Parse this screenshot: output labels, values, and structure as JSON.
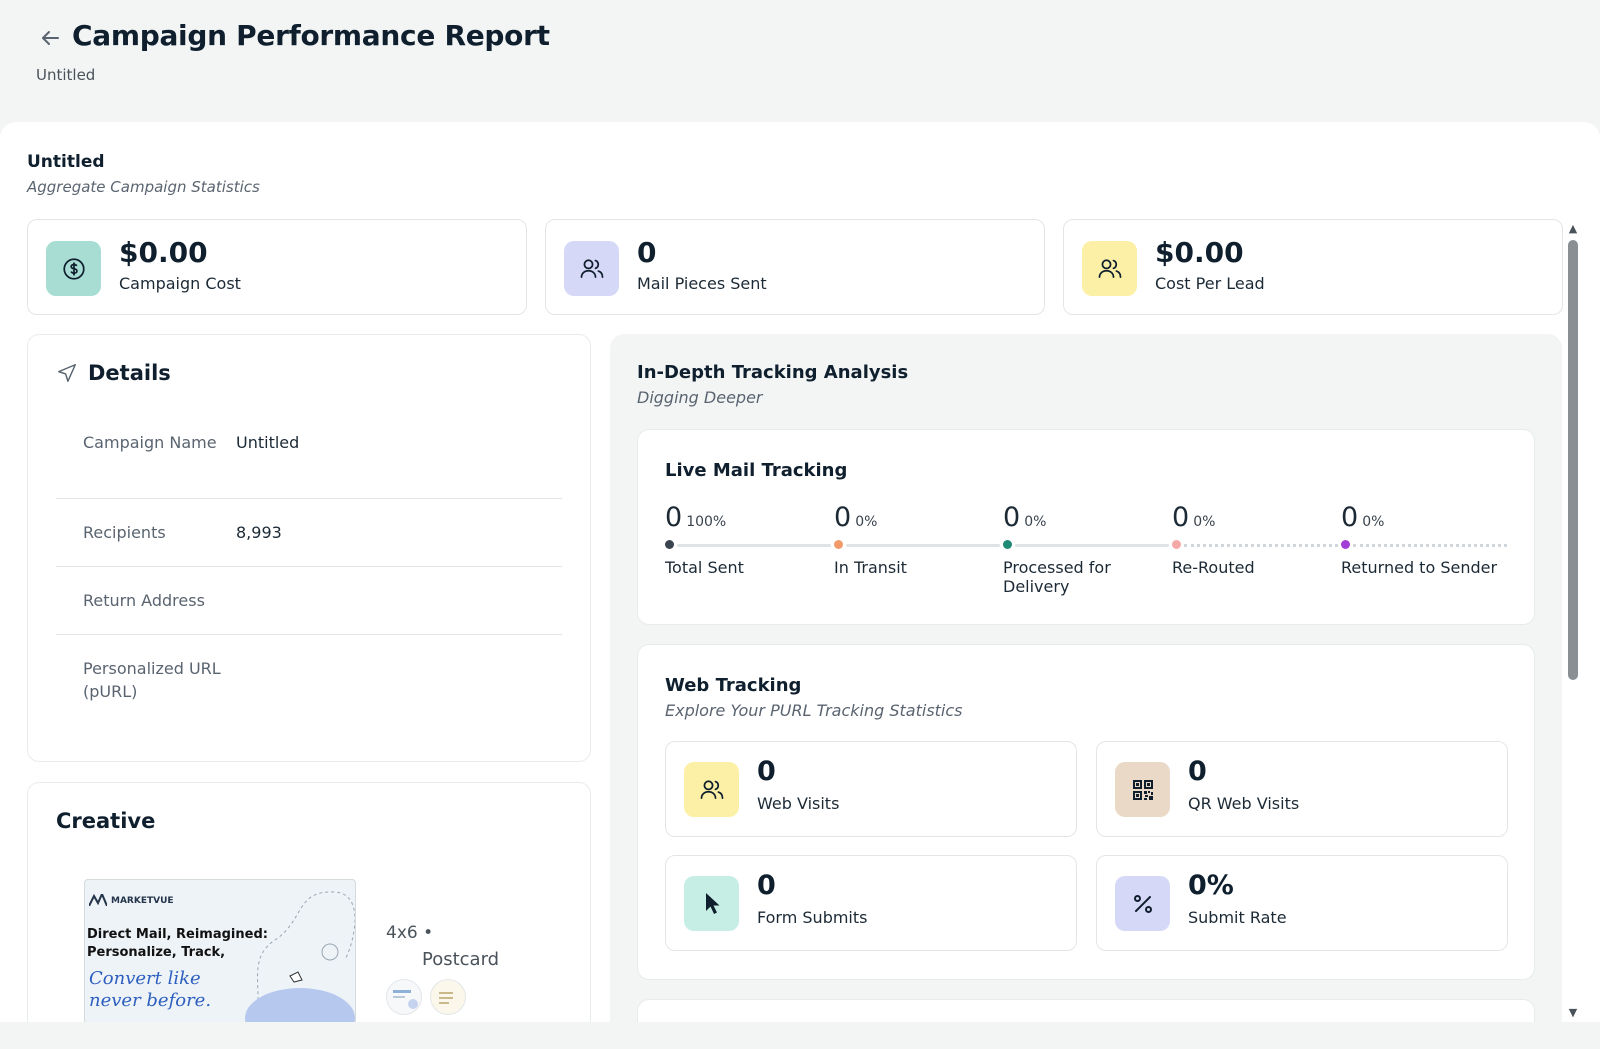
{
  "header": {
    "title": "Campaign Performance Report",
    "subtitle": "Untitled"
  },
  "summary": {
    "name": "Untitled",
    "subtitle": "Aggregate Campaign Statistics",
    "stats": [
      {
        "value": "$0.00",
        "label": "Campaign Cost",
        "icon": "dollar-circle-icon",
        "color": "#a8ddd4"
      },
      {
        "value": "0",
        "label": "Mail Pieces Sent",
        "icon": "users-icon",
        "color": "#d6d8f7"
      },
      {
        "value": "$0.00",
        "label": "Cost Per Lead",
        "icon": "users-icon",
        "color": "#fbf0a6"
      }
    ]
  },
  "details": {
    "title": "Details",
    "rows": [
      {
        "key": "Campaign Name",
        "value": "Untitled"
      },
      {
        "key": "Recipients",
        "value": "8,993"
      },
      {
        "key": "Return Address",
        "value": ""
      },
      {
        "key": "Personalized URL (pURL)",
        "value": ""
      }
    ]
  },
  "creative": {
    "title": "Creative",
    "postcard": {
      "brand": "MARKETVUE",
      "headline_1": "Direct Mail, Reimagined:",
      "headline_2": "Personalize, Track,",
      "script_1": "Convert like",
      "script_2": "never before."
    },
    "meta_size": "4x6 •",
    "meta_type": "Postcard"
  },
  "tracking": {
    "title": "In-Depth Tracking Analysis",
    "subtitle": "Digging Deeper",
    "live": {
      "title": "Live Mail Tracking",
      "milestones": [
        {
          "value": "0",
          "pct": "100%",
          "label": "Total Sent",
          "color": "#3a444e"
        },
        {
          "value": "0",
          "pct": "0%",
          "label": "In Transit",
          "color": "#f39a6a"
        },
        {
          "value": "0",
          "pct": "0%",
          "label": "Processed for Delivery",
          "color": "#1f8a76"
        },
        {
          "value": "0",
          "pct": "0%",
          "label": "Re-Routed",
          "color": "#f5a8a8"
        },
        {
          "value": "0",
          "pct": "0%",
          "label": "Returned to Sender",
          "color": "#a23fd6"
        }
      ]
    },
    "web": {
      "title": "Web Tracking",
      "subtitle": "Explore Your PURL Tracking Statistics",
      "stats": [
        {
          "value": "0",
          "label": "Web Visits",
          "icon": "users-icon",
          "color": "#fbf0a6"
        },
        {
          "value": "0",
          "label": "QR Web Visits",
          "icon": "qr-code-icon",
          "color": "#ead9c6"
        },
        {
          "value": "0",
          "label": "Form Submits",
          "icon": "cursor-icon",
          "color": "#c7eee4"
        },
        {
          "value": "0%",
          "label": "Submit Rate",
          "icon": "percent-icon",
          "color": "#d6d8f7"
        }
      ]
    }
  }
}
